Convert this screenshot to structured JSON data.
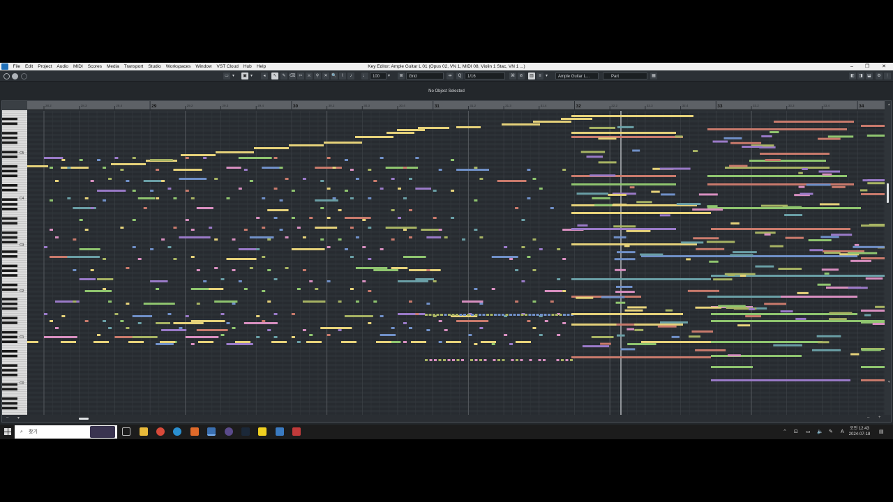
{
  "window": {
    "title": "Key Editor: Ample Guitar L 01 (Opus 02, VN 1, MIDI 08, Violin 1 Stac, VN 1 ...)",
    "controls": [
      "–",
      "❐",
      "✕"
    ]
  },
  "menu": [
    "File",
    "Edit",
    "Project",
    "Audio",
    "MIDI",
    "Scores",
    "Media",
    "Transport",
    "Studio",
    "Workspaces",
    "Window",
    "VST Cloud",
    "Hub",
    "Help"
  ],
  "toolbar": {
    "velocity": "100",
    "snap_type": "Grid",
    "quantize": "1/16",
    "track": "Ample Guitar L...",
    "part_mode": "Part"
  },
  "info_line": "No Object Selected",
  "ruler": {
    "labels": [
      {
        "t": "28.2",
        "major": false
      },
      {
        "t": "28.3",
        "major": false
      },
      {
        "t": "28.4",
        "major": false
      },
      {
        "t": "29",
        "major": true
      },
      {
        "t": "29.2",
        "major": false
      },
      {
        "t": "29.3",
        "major": false
      },
      {
        "t": "29.4",
        "major": false
      },
      {
        "t": "30",
        "major": true
      },
      {
        "t": "30.2",
        "major": false
      },
      {
        "t": "30.3",
        "major": false
      },
      {
        "t": "30.4",
        "major": false
      },
      {
        "t": "31",
        "major": true
      },
      {
        "t": "31.2",
        "major": false
      },
      {
        "t": "31.3",
        "major": false
      },
      {
        "t": "31.4",
        "major": false
      },
      {
        "t": "32",
        "major": true
      },
      {
        "t": "32.2",
        "major": false
      },
      {
        "t": "32.3",
        "major": false
      },
      {
        "t": "32.4",
        "major": false
      },
      {
        "t": "33",
        "major": true
      },
      {
        "t": "33.2",
        "major": false
      },
      {
        "t": "33.3",
        "major": false
      },
      {
        "t": "33.4",
        "major": false
      },
      {
        "t": "34",
        "major": true
      }
    ]
  },
  "keyboard": {
    "octave_labels": [
      "C5",
      "C4",
      "C3",
      "C2",
      "C1",
      "C0"
    ]
  },
  "colors": {
    "yellow": "#e6d27a",
    "salmon": "#c97a6c",
    "green": "#8fc56f",
    "blue": "#7090c8",
    "purple": "#9a7ac8",
    "teal": "#6a9fa6",
    "pink": "#d88fc0",
    "olive": "#a7b363"
  },
  "taskbar": {
    "search_placeholder": "찾기",
    "time": "오전 12:43",
    "date": "2024-07-18"
  }
}
